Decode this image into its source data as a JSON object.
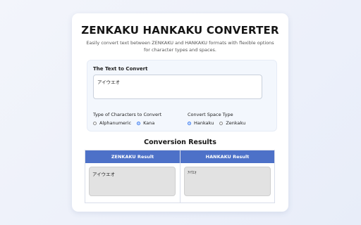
{
  "app": {
    "title": "ZENKAKU HANKAKU CONVERTER",
    "subtitle": "Easily convert text between ZENKAKU and HANKAKU formats with flexible options for character types and spaces."
  },
  "input": {
    "label": "The Text to Convert",
    "value": "アイウエオ"
  },
  "char_type": {
    "label": "Type of Characters to Convert",
    "options": [
      {
        "label": "Alphanumeric",
        "checked": false
      },
      {
        "label": "Kana",
        "checked": true
      }
    ]
  },
  "space_type": {
    "label": "Convert Space Type",
    "options": [
      {
        "label": "Hankaku",
        "checked": true
      },
      {
        "label": "Zenkaku",
        "checked": false
      }
    ]
  },
  "results": {
    "title": "Conversion Results",
    "zenkaku_header": "ZENKAKU Result",
    "hankaku_header": "HANKAKU Result",
    "zenkaku_value": "アイウエオ",
    "hankaku_value": "ｱｲｳｴｵ"
  },
  "colors": {
    "accent": "#3b7bf0",
    "table_header": "#4d71c8"
  }
}
